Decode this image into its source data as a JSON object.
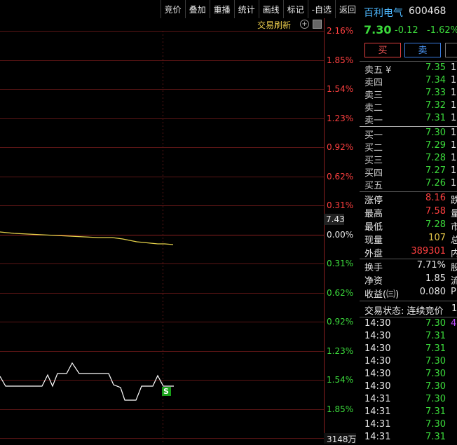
{
  "toolbar": {
    "items": [
      "竞价",
      "叠加",
      "重播",
      "统计",
      "画线",
      "标记",
      "-自选",
      "返回"
    ]
  },
  "subbar": {
    "refresh_label": "交易刷新",
    "plus_glyph": "+"
  },
  "chart": {
    "right_axis": [
      "2.16%",
      "1.85%",
      "1.54%",
      "1.23%",
      "0.92%",
      "0.62%",
      "0.31%",
      "0.00%",
      "0.31%",
      "0.62%",
      "0.92%",
      "1.23%",
      "1.54%",
      "1.85%"
    ],
    "axis_colors": [
      "#ff4040",
      "#ff4040",
      "#ff4040",
      "#ff4040",
      "#ff4040",
      "#ff4040",
      "#ff4040",
      "#e6e6e6",
      "#3cdb3c",
      "#3cdb3c",
      "#3cdb3c",
      "#3cdb3c",
      "#3cdb3c",
      "#3cdb3c"
    ],
    "price_marker": "7.43",
    "volume_label": "3148万",
    "signal_badge": "S",
    "price_line_color": "#e6d34a",
    "lower_line_color": "#ffffff"
  },
  "quote": {
    "name": "百利电气",
    "code": "600468",
    "price": "7.30",
    "change": "-0.12",
    "change_pct": "-1.62%",
    "buy_label": "买",
    "sell_label": "卖"
  },
  "asks": [
    {
      "label": "卖五 ¥",
      "price": "7.35"
    },
    {
      "label": "卖四",
      "price": "7.34"
    },
    {
      "label": "卖三",
      "price": "7.33"
    },
    {
      "label": "卖二",
      "price": "7.32"
    },
    {
      "label": "卖一",
      "price": "7.31"
    }
  ],
  "bids": [
    {
      "label": "买一",
      "price": "7.30"
    },
    {
      "label": "买二",
      "price": "7.29"
    },
    {
      "label": "买三",
      "price": "7.28"
    },
    {
      "label": "买四",
      "price": "7.27"
    },
    {
      "label": "买五",
      "price": "7.26"
    }
  ],
  "stats1": [
    {
      "label": "涨停",
      "value": "8.16",
      "color": "#ff4040",
      "right": "跌"
    },
    {
      "label": "最高",
      "value": "7.58",
      "color": "#ff4040",
      "right": "量"
    },
    {
      "label": "最低",
      "value": "7.28",
      "color": "#3cdb3c",
      "right": "市"
    },
    {
      "label": "现量",
      "value": "107",
      "color": "#e6c84a",
      "right": "总"
    },
    {
      "label": "外盘",
      "value": "389301",
      "color": "#ff4040",
      "right": "内"
    }
  ],
  "stats2": [
    {
      "label": "换手",
      "value": "7.71%",
      "right": "股"
    },
    {
      "label": "净资",
      "value": "1.85",
      "right": "流"
    },
    {
      "label": "收益(㈢)",
      "value": "0.080",
      "right": "PE"
    }
  ],
  "trade_status": "交易状态: 连续竞价",
  "trade_status_tail": "1",
  "ticks": [
    {
      "time": "14:30",
      "price": "7.30",
      "color": "#3cdb3c",
      "extra": "4"
    },
    {
      "time": "14:30",
      "price": "7.31",
      "color": "#3cdb3c",
      "extra": ""
    },
    {
      "time": "14:30",
      "price": "7.31",
      "color": "#3cdb3c",
      "extra": ""
    },
    {
      "time": "14:30",
      "price": "7.30",
      "color": "#3cdb3c",
      "extra": ""
    },
    {
      "time": "14:30",
      "price": "7.30",
      "color": "#3cdb3c",
      "extra": ""
    },
    {
      "time": "14:30",
      "price": "7.30",
      "color": "#3cdb3c",
      "extra": ""
    },
    {
      "time": "14:31",
      "price": "7.30",
      "color": "#3cdb3c",
      "extra": ""
    },
    {
      "time": "14:31",
      "price": "7.31",
      "color": "#3cdb3c",
      "extra": ""
    },
    {
      "time": "14:31",
      "price": "7.30",
      "color": "#3cdb3c",
      "extra": ""
    },
    {
      "time": "14:31",
      "price": "7.31",
      "color": "#3cdb3c",
      "extra": ""
    }
  ]
}
